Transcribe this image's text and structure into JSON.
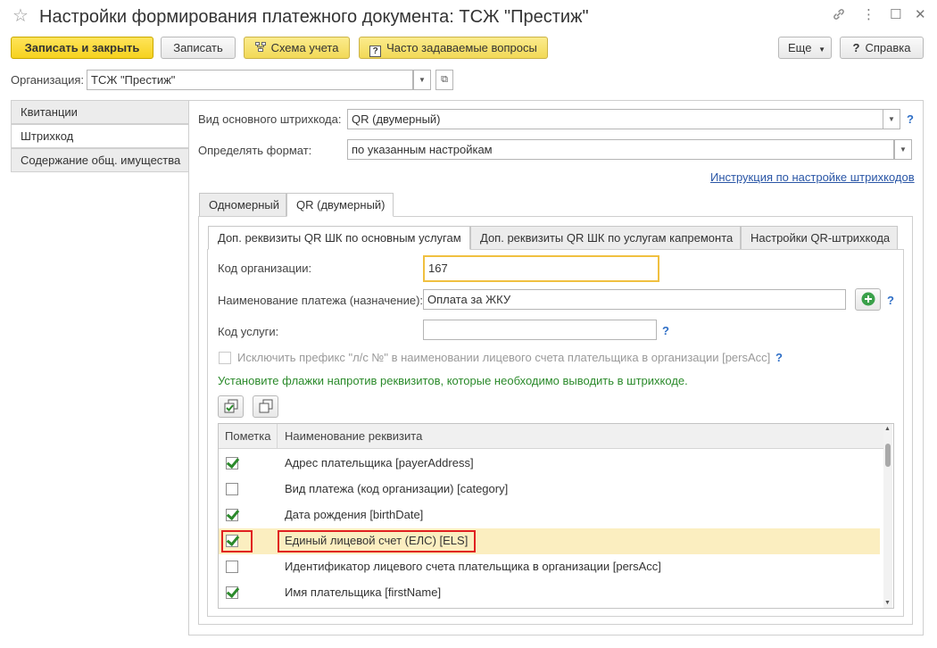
{
  "window": {
    "title": "Настройки формирования платежного документа: ТСЖ \"Престиж\"",
    "icons": {
      "favorite": "☆",
      "link": "🔗",
      "more": "⋮",
      "maximize": "☐",
      "close": "✕"
    }
  },
  "toolbar": {
    "save_close": "Записать и закрыть",
    "save": "Записать",
    "schema": "Схема учета",
    "faq": "Часто задаваемые вопросы",
    "more": "Еще",
    "help": "Справка"
  },
  "organization": {
    "label": "Организация:",
    "value": "ТСЖ \"Престиж\""
  },
  "nav": {
    "items": [
      {
        "label": "Квитанции"
      },
      {
        "label": "Штрихкод"
      },
      {
        "label": "Содержание общ. имущества"
      }
    ]
  },
  "barcode": {
    "type_label": "Вид основного штрихкода:",
    "type_value": "QR (двумерный)",
    "format_label": "Определять формат:",
    "format_value": "по указанным настройкам",
    "instruction_link": "Инструкция по настройке штрихкодов"
  },
  "outer_tabs": [
    {
      "label": "Одномерный"
    },
    {
      "label": "QR (двумерный)"
    }
  ],
  "inner_tabs": [
    {
      "label": "Доп. реквизиты QR ШК по основным услугам"
    },
    {
      "label": "Доп. реквизиты QR ШК по услугам капремонта"
    },
    {
      "label": "Настройки QR-штрихкода"
    }
  ],
  "form": {
    "org_code_label": "Код организации:",
    "org_code_value": "167",
    "payment_name_label": "Наименование платежа (назначение):",
    "payment_name_value": "Оплата за ЖКУ",
    "service_code_label": "Код услуги:",
    "service_code_value": "",
    "exclude_prefix_label": "Исключить префикс \"л/с №\" в наименовании лицевого счета плательщика в организации [persAcc]",
    "hint": "Установите флажки напротив реквизитов, которые необходимо выводить в штрихкоде."
  },
  "help_mark": "?",
  "table": {
    "columns": [
      "Пометка",
      "Наименование реквизита"
    ],
    "rows": [
      {
        "checked": true,
        "name": "Адрес плательщика [payerAddress]"
      },
      {
        "checked": false,
        "name": "Вид платежа (код организации) [category]"
      },
      {
        "checked": true,
        "name": "Дата рождения [birthDate]"
      },
      {
        "checked": true,
        "name": "Единый лицевой счет (ЕЛС) [ELS]",
        "selected": true
      },
      {
        "checked": false,
        "name": "Идентификатор лицевого счета плательщика в организации [persAcc]"
      },
      {
        "checked": true,
        "name": "Имя плательщика [firstName]"
      }
    ]
  }
}
